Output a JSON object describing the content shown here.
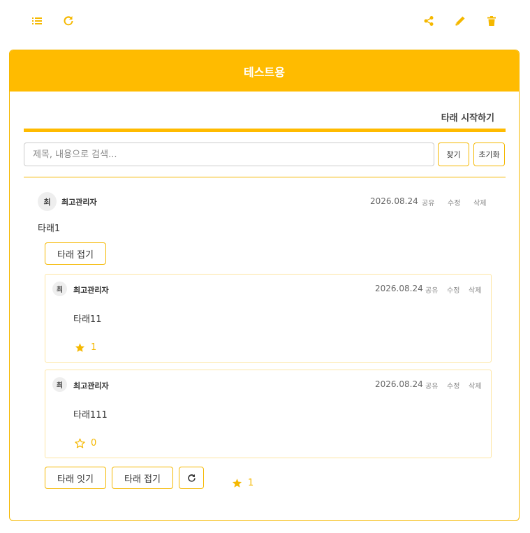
{
  "title": "테스트용",
  "tab": {
    "start_label": "타래 시작하기"
  },
  "search": {
    "placeholder": "제목, 내용으로 검색...",
    "find_label": "찾기",
    "reset_label": "초기화"
  },
  "post": {
    "avatar": "최",
    "author": "최고관리자",
    "date": "2026.08.24",
    "share": "공유",
    "edit": "수정",
    "delete": "삭제",
    "content": "타래1",
    "fold_label": "타래 접기"
  },
  "replies": [
    {
      "avatar": "최",
      "author": "최고관리자",
      "date": "2026.08.24",
      "share": "공유",
      "edit": "수정",
      "delete": "삭제",
      "content": "타래11",
      "likes": "1",
      "liked": true
    },
    {
      "avatar": "최",
      "author": "최고관리자",
      "date": "2026.08.24",
      "share": "공유",
      "edit": "수정",
      "delete": "삭제",
      "content": "타래111",
      "likes": "0",
      "liked": false
    }
  ],
  "footer": {
    "continue_label": "타래 잇기",
    "fold_label": "타래 접기",
    "likes": "1"
  },
  "icons": {
    "toolbar_left": [
      "list-icon",
      "refresh-icon"
    ],
    "toolbar_right": [
      "share-icon",
      "pencil-icon",
      "trash-icon"
    ]
  },
  "colors": {
    "accent": "#ffbb00",
    "border": "#f5b800"
  }
}
